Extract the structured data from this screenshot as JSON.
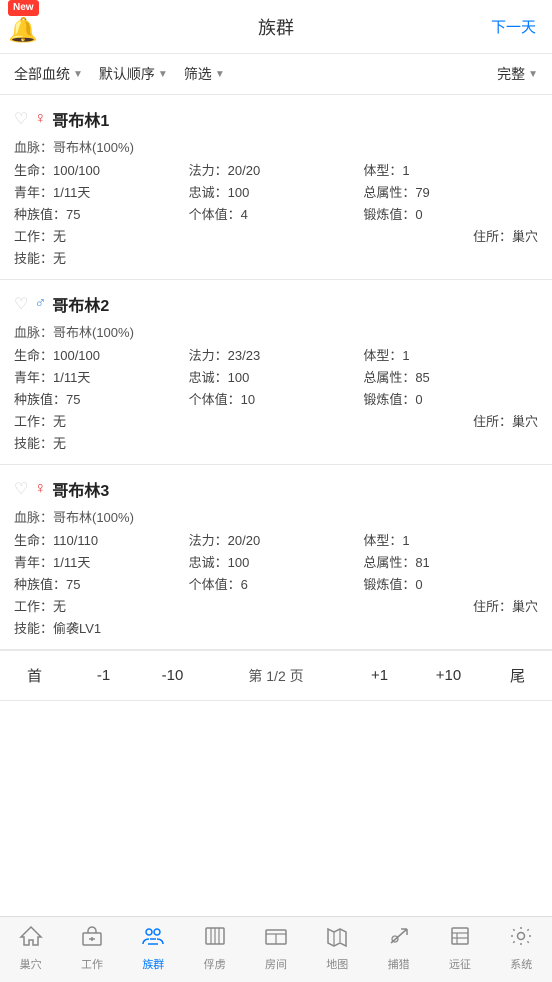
{
  "header": {
    "title": "族群",
    "next_label": "下一天",
    "new_badge": "New"
  },
  "filter_bar": {
    "bloodline": "全部血统",
    "order": "默认顺序",
    "filter": "筛选",
    "completeness": "完整"
  },
  "creatures": [
    {
      "id": 1,
      "name": "哥布林1",
      "gender": "female",
      "bloodline": "哥布林(100%)",
      "hp": "100/100",
      "mp": "20/20",
      "body_type": "1",
      "youth": "1/11天",
      "loyalty": "100",
      "total_attr": "79",
      "tribe_value": "75",
      "individual_value": "4",
      "forge_value": "0",
      "work": "无",
      "home": "巢穴",
      "skill": "无"
    },
    {
      "id": 2,
      "name": "哥布林2",
      "gender": "male",
      "bloodline": "哥布林(100%)",
      "hp": "100/100",
      "mp": "23/23",
      "body_type": "1",
      "youth": "1/11天",
      "loyalty": "100",
      "total_attr": "85",
      "tribe_value": "75",
      "individual_value": "10",
      "forge_value": "0",
      "work": "无",
      "home": "巢穴",
      "skill": "无"
    },
    {
      "id": 3,
      "name": "哥布林3",
      "gender": "female",
      "bloodline": "哥布林(100%)",
      "hp": "110/110",
      "mp": "20/20",
      "body_type": "1",
      "youth": "1/11天",
      "loyalty": "100",
      "total_attr": "81",
      "tribe_value": "75",
      "individual_value": "6",
      "forge_value": "0",
      "work": "无",
      "home": "巢穴",
      "skill": "偷袭LV1"
    }
  ],
  "pagination": {
    "first": "首",
    "prev1": "-1",
    "prev10": "-10",
    "page_info": "第 1/2 页",
    "next1": "+1",
    "next10": "+10",
    "last": "尾"
  },
  "nav": [
    {
      "id": "cave",
      "label": "巢穴",
      "icon": "🏠",
      "active": false
    },
    {
      "id": "work",
      "label": "工作",
      "icon": "🏗",
      "active": false
    },
    {
      "id": "tribe",
      "label": "族群",
      "icon": "⚔",
      "active": true
    },
    {
      "id": "prison",
      "label": "俘虏",
      "icon": "🔲",
      "active": false
    },
    {
      "id": "room",
      "label": "房间",
      "icon": "🏠",
      "active": false
    },
    {
      "id": "map",
      "label": "地图",
      "icon": "🗺",
      "active": false
    },
    {
      "id": "hunt",
      "label": "捕猎",
      "icon": "✂",
      "active": false
    },
    {
      "id": "remote",
      "label": "远征",
      "icon": "📋",
      "active": false
    },
    {
      "id": "system",
      "label": "系统",
      "icon": "⚙",
      "active": false
    }
  ]
}
